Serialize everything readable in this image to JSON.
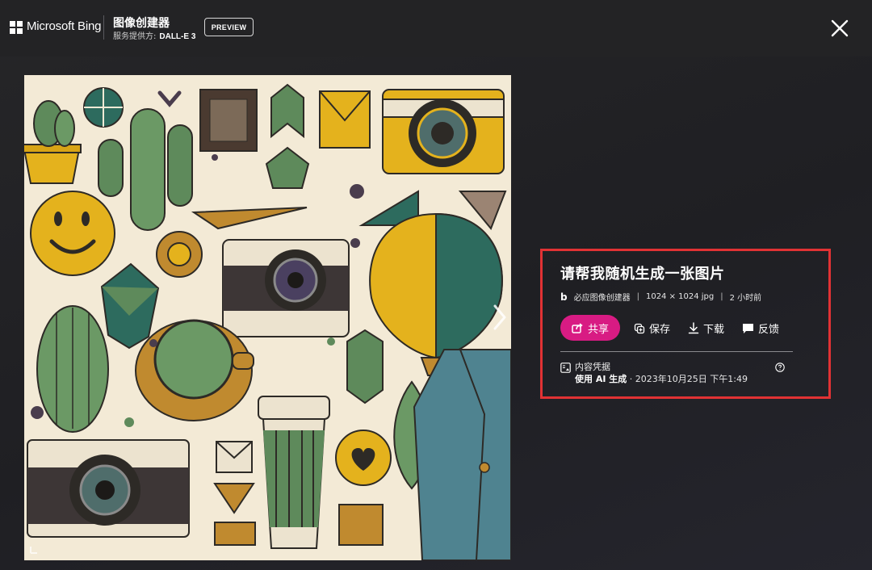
{
  "header": {
    "brand": "Microsoft Bing",
    "app_title": "图像创建器",
    "provider_label": "服务提供方:",
    "provider_name": "DALL-E 3",
    "badge": "PREVIEW"
  },
  "image": {
    "alt": "Flat illustration collage: cacti, cameras, smiley face, hot air balloon, coffee cup, denim jacket"
  },
  "info": {
    "prompt": "请帮我随机生成一张图片",
    "source_icon": "b",
    "source": "必应图像创建器",
    "dimensions": "1024 × 1024 jpg",
    "time": "2 小时前"
  },
  "actions": {
    "share": "共享",
    "save": "保存",
    "download": "下载",
    "feedback": "反馈"
  },
  "credentials": {
    "label": "内容凭据",
    "generated_by": "使用 AI 生成",
    "date": " · 2023年10月25日 下午1:49"
  },
  "colors": {
    "share_accent": "#d81b83",
    "highlight": "#e13234",
    "background": "#1f1f23"
  }
}
